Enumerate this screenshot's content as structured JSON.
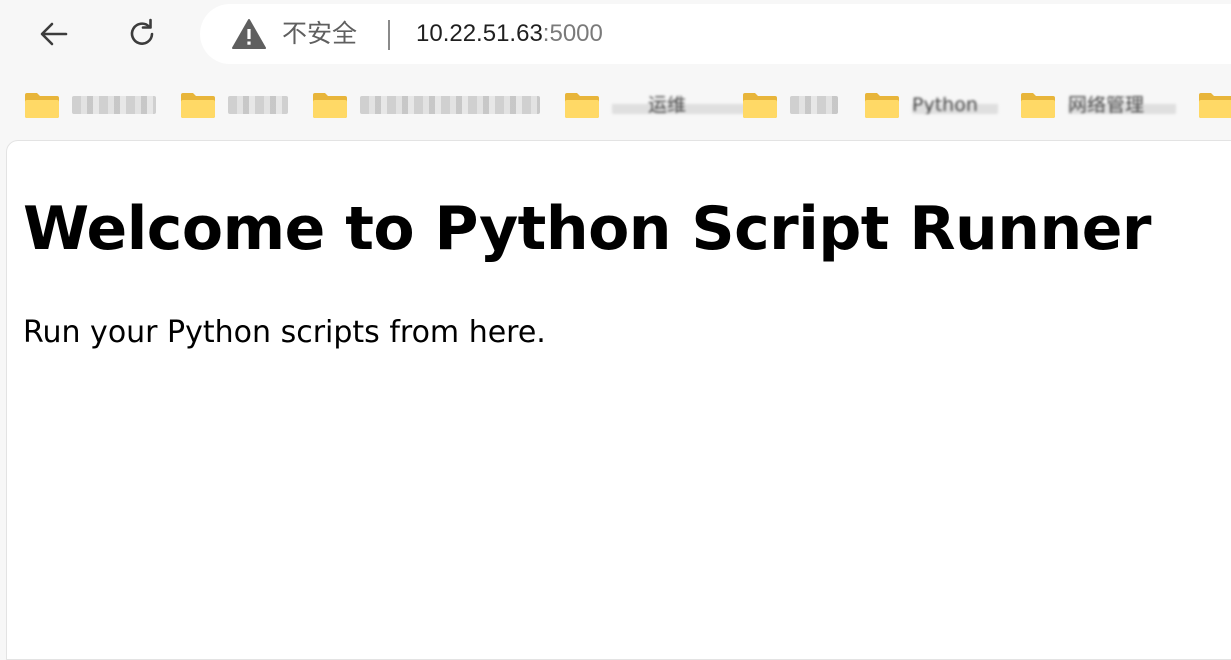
{
  "browser": {
    "security_label": "不安全",
    "url_host": "10.22.51.63",
    "url_port": ":5000",
    "icons": {
      "back": "back-arrow-icon",
      "reload": "reload-icon",
      "warning": "warning-triangle-icon",
      "folder": "folder-icon"
    }
  },
  "bookmarks": [
    {
      "label": "",
      "redacted": true
    },
    {
      "label": "",
      "redacted": true
    },
    {
      "label": "",
      "redacted": true
    },
    {
      "label": "运维",
      "redacted": true
    },
    {
      "label": "",
      "redacted": true
    },
    {
      "label": "Python",
      "redacted": true
    },
    {
      "label": "网络管理",
      "redacted": true
    },
    {
      "label": "",
      "redacted": true
    }
  ],
  "page": {
    "heading": "Welcome to Python Script Runner",
    "paragraph": "Run your Python scripts from here."
  },
  "colors": {
    "toolbar_bg": "#f7f7f7",
    "folder_yellow": "#f5c542",
    "folder_light": "#ffd966",
    "text_primary": "#000000",
    "text_muted": "#5f5f5f"
  }
}
